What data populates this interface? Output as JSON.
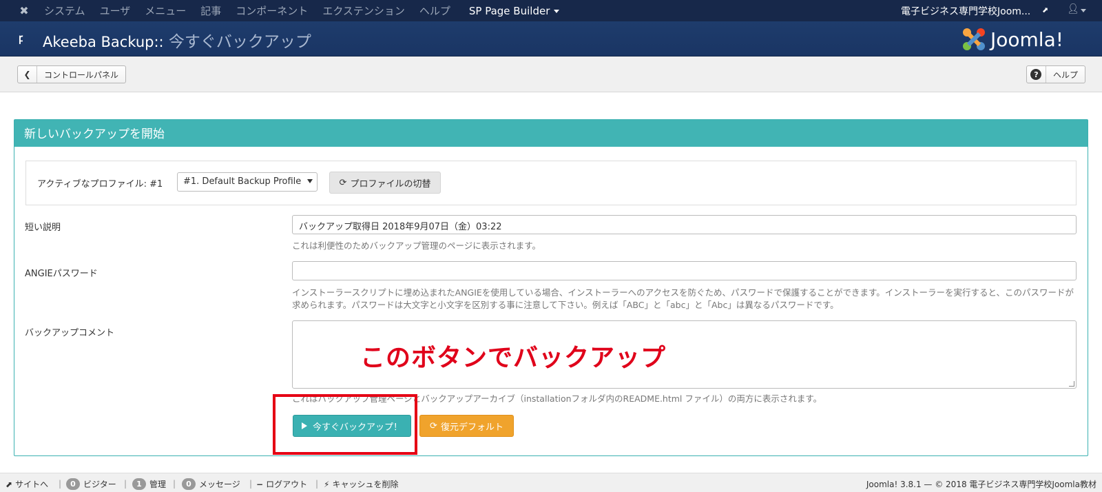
{
  "menubar": {
    "items": [
      "システム",
      "ユーザ",
      "メニュー",
      "記事",
      "コンポーネント",
      "エクステンション",
      "ヘルプ"
    ],
    "sp_page_builder": "SP Page Builder",
    "site_name": "電子ビジネス専門学校Joom..."
  },
  "header": {
    "title_main": "Akeeba Backup::",
    "title_sub": " 今すぐバックアップ",
    "brand": "Joomla!",
    "brand_colors": [
      "#f9a541",
      "#f44321",
      "#5091cd",
      "#7ac143"
    ]
  },
  "toolbar": {
    "back_label": "コントロールパネル",
    "help_label": "ヘルプ"
  },
  "panel": {
    "heading": "新しいバックアップを開始",
    "active_profile_label": "アクティブなプロファイル: #1",
    "profile_select_value": "#1. Default Backup Profile",
    "switch_profile_label": "プロファイルの切替",
    "description_label": "短い説明",
    "description_value": "バックアップ取得日 2018年9月07日（金）03:22",
    "description_help": "これは利便性のためバックアップ管理のページに表示されます。",
    "angie_label": "ANGIEパスワード",
    "angie_value": "",
    "angie_help_1": "インストーラースクリプトに埋め込まれたANGIEを使用している場合、インストーラーへのアクセスを防ぐため、パスワードで保護することができます。インストーラーを実行すると、このパスワードが",
    "angie_help_2": "求められます。パスワードは大文字と小文字を区別する事に注意して下さい。例えば「ABC」と「abc」と「Abc」は異なるパスワードです。",
    "comment_label": "バックアップコメント",
    "comment_help": "これはバックアップ管理ページとバックアップアーカイブ（installationフォルダ内のREADME.html ファイル）の両方に表示されます。",
    "annotation": "このボタンでバックアップ",
    "backup_now_label": "今すぐバックアップ！",
    "reset_label": "復元デフォルト"
  },
  "footer": {
    "view_site": "サイトへ",
    "visitors_count": "0",
    "visitors_label": "ビジター",
    "admins_count": "1",
    "admins_label": "管理",
    "messages_count": "0",
    "messages_label": "メッセージ",
    "logout": "ログアウト",
    "clear_cache": "キャッシュを削除",
    "copyright": "Joomla! 3.8.1 — © 2018 電子ビジネス専門学校Joomla教材"
  }
}
